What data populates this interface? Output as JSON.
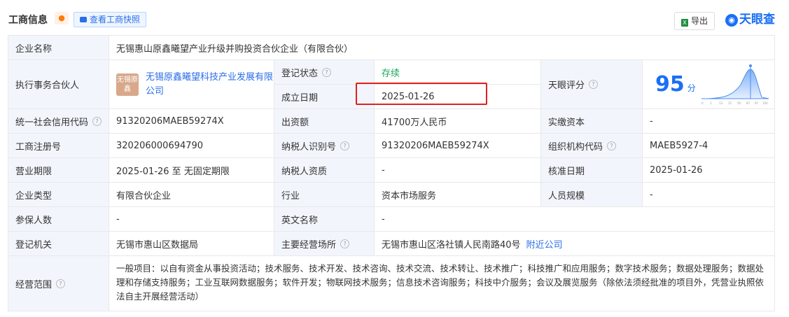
{
  "header": {
    "title": "工商信息",
    "snapshot_label": "查看工商快照",
    "export_label": "导出",
    "brand": "天眼查"
  },
  "rows": {
    "company_name": {
      "label": "企业名称",
      "value": "无锡惠山原鑫曦望产业升级并购投资合伙企业（有限合伙）"
    },
    "partner": {
      "label": "执行事务合伙人",
      "seal": "无锡原鑫",
      "value": "无锡原鑫曦望科技产业发展有限公司"
    },
    "reg_status": {
      "label": "登记状态",
      "value": "存续"
    },
    "est_date": {
      "label": "成立日期",
      "value": "2025-01-26"
    },
    "rating": {
      "label": "天眼评分",
      "score": "95",
      "unit": "分",
      "axis": [
        "0",
        "1",
        "13",
        "15",
        "50",
        "87",
        "97",
        "100"
      ]
    },
    "credit_code": {
      "label": "统一社会信用代码",
      "value": "91320206MAEB59274X"
    },
    "capital": {
      "label": "出资额",
      "value": "41700万人民币"
    },
    "paid_capital": {
      "label": "实缴资本",
      "value": "-"
    },
    "reg_number": {
      "label": "工商注册号",
      "value": "320206000694790"
    },
    "taxpayer_id": {
      "label": "纳税人识别号",
      "value": "91320206MAEB59274X"
    },
    "org_code": {
      "label": "组织机构代码",
      "value": "MAEB5927-4"
    },
    "term": {
      "label": "营业期限",
      "value": "2025-01-26 至 无固定期限"
    },
    "tax_qual": {
      "label": "纳税人资质",
      "value": "-"
    },
    "approve_date": {
      "label": "核准日期",
      "value": "2025-01-26"
    },
    "type": {
      "label": "企业类型",
      "value": "有限合伙企业"
    },
    "industry": {
      "label": "行业",
      "value": "资本市场服务"
    },
    "staff": {
      "label": "人员规模",
      "value": "-"
    },
    "insured": {
      "label": "参保人数",
      "value": "-"
    },
    "english_name": {
      "label": "英文名称",
      "value": "-"
    },
    "authority": {
      "label": "登记机关",
      "value": "无锡市惠山区数据局"
    },
    "address": {
      "label": "主要经营场所",
      "value": "无锡市惠山区洛社镇人民南路40号",
      "link": "附近公司"
    },
    "scope": {
      "label": "经营范围",
      "value": "一般项目：以自有资金从事投资活动；技术服务、技术开发、技术咨询、技术交流、技术转让、技术推广；科技推广和应用服务；数字技术服务；数据处理服务；数据处理和存储支持服务；工业互联网数据服务；软件开发；物联网技术服务；信息技术咨询服务；科技中介服务；会议及展览服务（除依法须经批准的项目外，凭营业执照依法自主开展经营活动）"
    }
  }
}
